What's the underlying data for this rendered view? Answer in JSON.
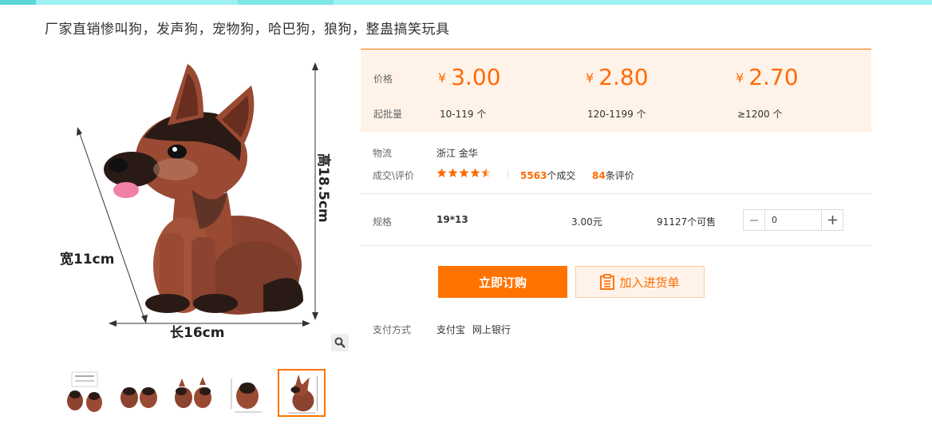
{
  "product": {
    "title": "厂家直销惨叫狗，发声狗，宠物狗，哈巴狗，狼狗，整蛊搞笑玩具",
    "image_labels": {
      "height": "高18.5cm",
      "width": "宽11cm",
      "length": "长16cm"
    }
  },
  "thumbnails": [
    {
      "name": "thumb-1"
    },
    {
      "name": "thumb-2"
    },
    {
      "name": "thumb-3"
    },
    {
      "name": "thumb-4"
    },
    {
      "name": "thumb-5",
      "active": true
    }
  ],
  "pricing": {
    "price_label": "价格",
    "moq_label": "起批量",
    "currency": "¥",
    "tiers": [
      {
        "price": "3.00",
        "range": "10-119 个"
      },
      {
        "price": "2.80",
        "range": "120-1199 个"
      },
      {
        "price": "2.70",
        "range": "≥1200 个"
      }
    ]
  },
  "logistics": {
    "label": "物流",
    "value": "浙江 金华"
  },
  "reviews": {
    "label": "成交\\评价",
    "rating": 4.5,
    "deals_count": "5563",
    "deals_suffix": "个成交",
    "review_count": "84",
    "review_suffix": "条评价"
  },
  "spec": {
    "label": "规格",
    "name": "19*13",
    "price": "3.00元",
    "stock": "91127个可售",
    "quantity": "0"
  },
  "actions": {
    "order": "立即订购",
    "cart": "加入进货单"
  },
  "payment": {
    "label": "支付方式",
    "methods": [
      "支付宝",
      "网上银行"
    ]
  },
  "colors": {
    "accent": "#ff7300",
    "price_bg": "#fff3e9",
    "dog_body": "#9a4a32",
    "dog_dark": "#2a1a16",
    "tongue": "#f080a8"
  },
  "icons": [
    "search-icon",
    "minus-icon",
    "plus-icon",
    "clipboard-icon",
    "star-icon"
  ]
}
